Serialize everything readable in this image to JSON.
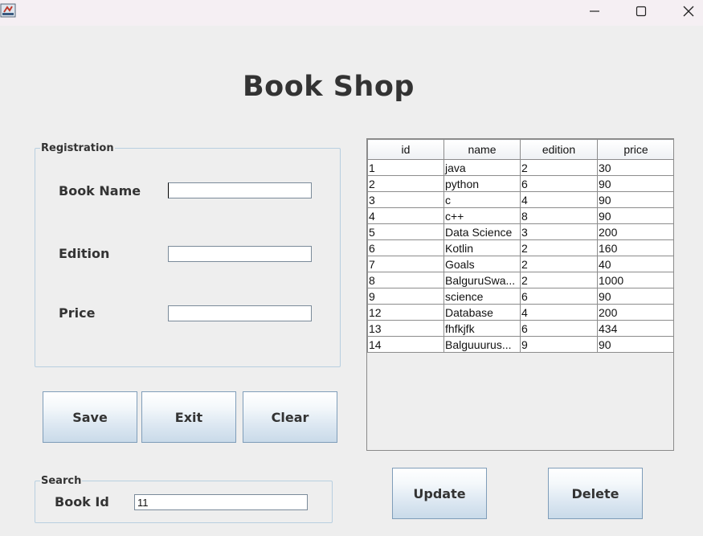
{
  "window": {
    "app_icon": "java-coffee-cup-icon",
    "controls": [
      "minimize-icon",
      "maximize-icon",
      "close-icon"
    ]
  },
  "title": "Book Shop",
  "registration": {
    "legend": "Registration",
    "book_name_label": "Book Name",
    "book_name_value": "",
    "edition_label": "Edition",
    "edition_value": "",
    "price_label": "Price",
    "price_value": ""
  },
  "buttons": {
    "save": "Save",
    "exit": "Exit",
    "clear": "Clear",
    "update": "Update",
    "delete": "Delete"
  },
  "search": {
    "legend": "Search",
    "book_id_label": "Book Id",
    "book_id_value": "11"
  },
  "table": {
    "columns": [
      "id",
      "name",
      "edition",
      "price"
    ],
    "rows": [
      [
        "1",
        "java",
        "2",
        "30"
      ],
      [
        "2",
        "python",
        "6",
        "90"
      ],
      [
        "3",
        "c",
        "4",
        "90"
      ],
      [
        "4",
        "c++",
        "8",
        "90"
      ],
      [
        "5",
        "Data Science",
        "3",
        "200"
      ],
      [
        "6",
        "Kotlin",
        "2",
        "160"
      ],
      [
        "7",
        "Goals",
        "2",
        "40"
      ],
      [
        "8",
        "BalguruSwa...",
        "2",
        "1000"
      ],
      [
        "9",
        "science",
        "6",
        "90"
      ],
      [
        "12",
        "Database",
        "4",
        "200"
      ],
      [
        "13",
        "fhfkjfk",
        "6",
        "434"
      ],
      [
        "14",
        "Balguuurus...",
        "9",
        "90"
      ]
    ]
  }
}
